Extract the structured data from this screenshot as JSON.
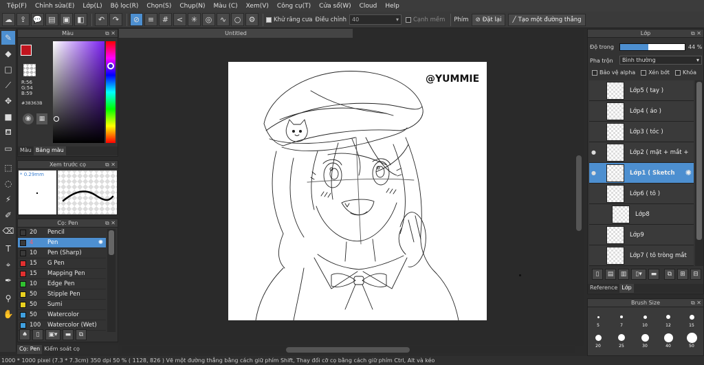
{
  "menu": [
    "Tệp(F)",
    "Chỉnh sửa(E)",
    "Lớp(L)",
    "Bộ lọc(R)",
    "Chọn(S)",
    "Chụp(N)",
    "Màu (C)",
    "Xem(V)",
    "Công cụ(T)",
    "Cửa sổ(W)",
    "Cloud",
    "Help"
  ],
  "toolbar": {
    "antialias_label": "Khử răng cưa",
    "adjust_label": "Điều chỉnh",
    "adjust_value": "40",
    "edge_label": "Cạnh mềm",
    "key_label": "Phím",
    "reset_label": "Đặt lại",
    "straight_line_label": "Tạo một đường thẳng"
  },
  "color_panel": {
    "title": "Màu",
    "r": "R:56",
    "g": "G:54",
    "b": "B:59",
    "hex": "#38363B",
    "tabs": [
      "Màu",
      "Bảng màu"
    ]
  },
  "preview_panel": {
    "title": "Xem trước cọ",
    "size": "* 0.29mm"
  },
  "brush_panel": {
    "title": "Cọ: Pen",
    "items": [
      {
        "size": "20",
        "name": "Pencil",
        "color": "#3a3a3a"
      },
      {
        "size": "4",
        "name": "Pen",
        "color": "#3a3a3a"
      },
      {
        "size": "10",
        "name": "Pen (Sharp)",
        "color": "#3a3a3a"
      },
      {
        "size": "15",
        "name": "G Pen",
        "color": "#e03030"
      },
      {
        "size": "15",
        "name": "Mapping Pen",
        "color": "#e03030"
      },
      {
        "size": "10",
        "name": "Edge Pen",
        "color": "#30c030"
      },
      {
        "size": "50",
        "name": "Stipple Pen",
        "color": "#e8d020"
      },
      {
        "size": "50",
        "name": "Sumi",
        "color": "#e8d020"
      },
      {
        "size": "50",
        "name": "Watercolor",
        "color": "#40a0e0"
      },
      {
        "size": "100",
        "name": "Watercolor (Wet)",
        "color": "#40a0e0"
      }
    ],
    "tabs": [
      "Cọ: Pen",
      "Kiểm soát cọ"
    ]
  },
  "canvas": {
    "doc_title": "Untitled",
    "watermark": "@YUMMIE"
  },
  "layer_panel": {
    "title": "Lớp",
    "opacity_label": "Độ trong",
    "opacity_value": "44 %",
    "opacity_fraction": 0.44,
    "blend_label": "Pha trộn",
    "blend_value": "Bình thường",
    "protect_alpha": "Bảo vệ alpha",
    "clipping": "Xén bớt",
    "lock": "Khóa",
    "layers": [
      {
        "name": "Lớp5 ( tay )",
        "visible": "",
        "selected": false
      },
      {
        "name": "Lớp4 ( áo )",
        "visible": "",
        "selected": false
      },
      {
        "name": "Lớp3 ( tóc )",
        "visible": "",
        "selected": false
      },
      {
        "name": "Lớp2 ( mặt + mắt + ",
        "visible": "●",
        "selected": false
      },
      {
        "name": "Lớp1 ( Sketch",
        "visible": "●",
        "selected": true
      },
      {
        "name": "Lớp6 ( tô )",
        "visible": "",
        "selected": false
      },
      {
        "name": "Lớp8",
        "visible": "",
        "selected": false
      },
      {
        "name": "Lớp9",
        "visible": "",
        "selected": false
      },
      {
        "name": "Lớp7 ( tô tròng mắt",
        "visible": "",
        "selected": false
      }
    ],
    "tabs": [
      "Reference",
      "Lớp"
    ]
  },
  "brush_size_panel": {
    "title": "Brush Size",
    "sizes": [
      "5",
      "7",
      "10",
      "12",
      "15",
      "20",
      "25",
      "30",
      "40",
      "50"
    ]
  },
  "status": "1000 * 1000 pixel  (7.3 * 7.3cm)  350 dpi  50 %  ( 1128, 826 )  Vẽ một đường thẳng bằng cách giữ phím Shift, Thay đổi cỡ cọ bằng cách giữ phím Ctrl, Alt và kéo"
}
